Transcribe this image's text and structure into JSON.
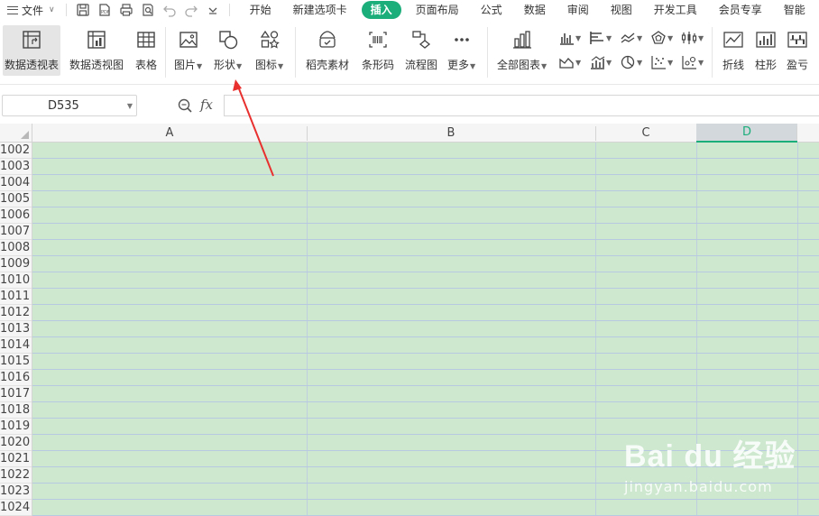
{
  "menu": {
    "file_label": "文件",
    "tabs": [
      "开始",
      "新建选项卡",
      "插入",
      "页面布局",
      "公式",
      "数据",
      "审阅",
      "视图",
      "开发工具",
      "会员专享",
      "智能"
    ],
    "active_tab": "插入"
  },
  "ribbon": {
    "pivot_table": "数据透视表",
    "pivot_chart": "数据透视图",
    "table": "表格",
    "picture": "图片",
    "shape": "形状",
    "icon": "图标",
    "material": "稻壳素材",
    "barcode": "条形码",
    "flowchart": "流程图",
    "more": "更多",
    "all_charts": "全部图表",
    "line": "折线",
    "column": "柱形",
    "winloss": "盈亏"
  },
  "formula_bar": {
    "cell_ref": "D535",
    "fx_label": "fx",
    "formula": ""
  },
  "grid": {
    "columns": [
      "A",
      "B",
      "C",
      "D"
    ],
    "selected_column": "D",
    "rows": [
      "1002",
      "1003",
      "1004",
      "1005",
      "1006",
      "1007",
      "1008",
      "1009",
      "1010",
      "1011",
      "1012",
      "1013",
      "1014",
      "1015",
      "1016",
      "1017",
      "1018",
      "1019",
      "1020",
      "1021",
      "1022",
      "1023",
      "1024"
    ]
  },
  "colors": {
    "accent": "#1bad7a",
    "cell_fill": "#cde8cf",
    "annotation_arrow": "#e8302f"
  },
  "watermark": {
    "logo": "Bai du 经验",
    "url": "jingyan.baidu.com"
  }
}
